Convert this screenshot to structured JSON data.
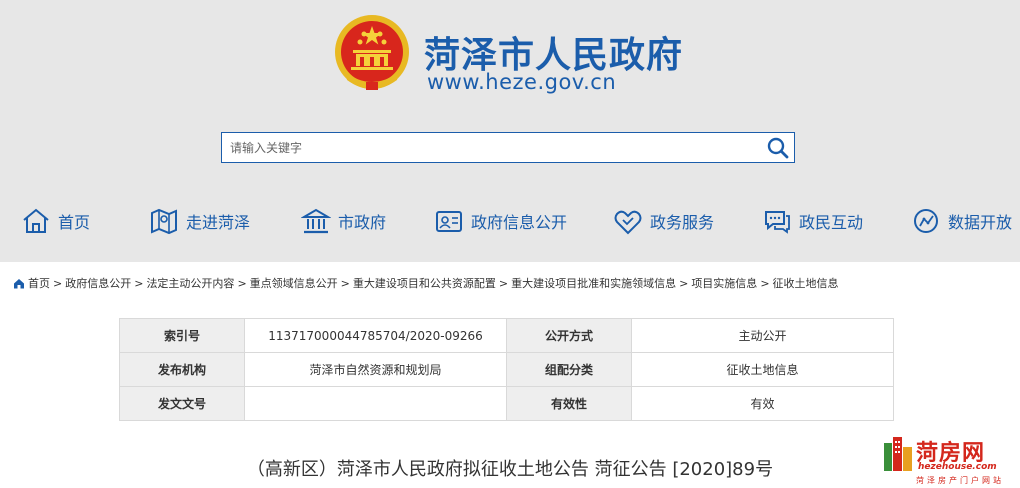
{
  "header": {
    "title": "菏泽市人民政府",
    "url": "www.heze.gov.cn"
  },
  "search": {
    "placeholder": "请输入关键字"
  },
  "nav": [
    {
      "label": "首页",
      "icon": "home-icon"
    },
    {
      "label": "走进菏泽",
      "icon": "map-icon"
    },
    {
      "label": "市政府",
      "icon": "government-building-icon"
    },
    {
      "label": "政府信息公开",
      "icon": "info-card-icon"
    },
    {
      "label": "政务服务",
      "icon": "handshake-icon"
    },
    {
      "label": "政民互动",
      "icon": "chat-icon"
    },
    {
      "label": "数据开放",
      "icon": "data-globe-icon"
    }
  ],
  "breadcrumb": [
    "首页",
    "政府信息公开",
    "法定主动公开内容",
    "重点领域信息公开",
    "重大建设项目和公共资源配置",
    "重大建设项目批准和实施领域信息",
    "项目实施信息",
    "征收土地信息"
  ],
  "info": {
    "index_no_label": "索引号",
    "index_no": "11371700004478570 4/2020-09266",
    "open_mode_label": "公开方式",
    "open_mode": "主动公开",
    "publisher_label": "发布机构",
    "publisher": "菏泽市自然资源和规划局",
    "category_label": "组配分类",
    "category": "征收土地信息",
    "doc_no_label": "发文文号",
    "doc_no": "",
    "validity_label": "有效性",
    "validity": "有效"
  },
  "document": {
    "title": "（高新区）菏泽市人民政府拟征收土地公告 菏征公告 [2020]89号"
  },
  "watermark": {
    "brand": "菏房网",
    "domain": "hezehouse.com",
    "tagline": "菏泽房产门户网站"
  },
  "colors": {
    "brand_blue": "#1b5dab",
    "header_bg": "#e7e7e7",
    "watermark_red": "#d4271c"
  }
}
